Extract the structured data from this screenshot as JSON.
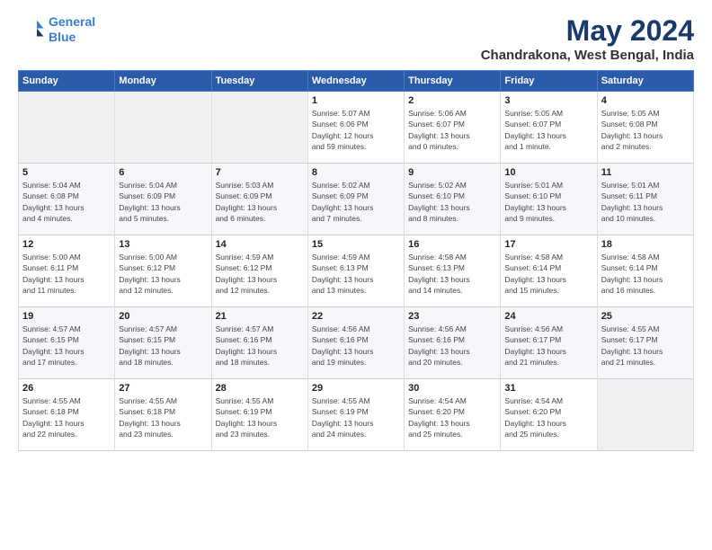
{
  "header": {
    "logo_line1": "General",
    "logo_line2": "Blue",
    "title": "May 2024",
    "location": "Chandrakona, West Bengal, India"
  },
  "weekdays": [
    "Sunday",
    "Monday",
    "Tuesday",
    "Wednesday",
    "Thursday",
    "Friday",
    "Saturday"
  ],
  "weeks": [
    [
      {
        "num": "",
        "info": ""
      },
      {
        "num": "",
        "info": ""
      },
      {
        "num": "",
        "info": ""
      },
      {
        "num": "1",
        "info": "Sunrise: 5:07 AM\nSunset: 6:06 PM\nDaylight: 12 hours\nand 59 minutes."
      },
      {
        "num": "2",
        "info": "Sunrise: 5:06 AM\nSunset: 6:07 PM\nDaylight: 13 hours\nand 0 minutes."
      },
      {
        "num": "3",
        "info": "Sunrise: 5:05 AM\nSunset: 6:07 PM\nDaylight: 13 hours\nand 1 minute."
      },
      {
        "num": "4",
        "info": "Sunrise: 5:05 AM\nSunset: 6:08 PM\nDaylight: 13 hours\nand 2 minutes."
      }
    ],
    [
      {
        "num": "5",
        "info": "Sunrise: 5:04 AM\nSunset: 6:08 PM\nDaylight: 13 hours\nand 4 minutes."
      },
      {
        "num": "6",
        "info": "Sunrise: 5:04 AM\nSunset: 6:09 PM\nDaylight: 13 hours\nand 5 minutes."
      },
      {
        "num": "7",
        "info": "Sunrise: 5:03 AM\nSunset: 6:09 PM\nDaylight: 13 hours\nand 6 minutes."
      },
      {
        "num": "8",
        "info": "Sunrise: 5:02 AM\nSunset: 6:09 PM\nDaylight: 13 hours\nand 7 minutes."
      },
      {
        "num": "9",
        "info": "Sunrise: 5:02 AM\nSunset: 6:10 PM\nDaylight: 13 hours\nand 8 minutes."
      },
      {
        "num": "10",
        "info": "Sunrise: 5:01 AM\nSunset: 6:10 PM\nDaylight: 13 hours\nand 9 minutes."
      },
      {
        "num": "11",
        "info": "Sunrise: 5:01 AM\nSunset: 6:11 PM\nDaylight: 13 hours\nand 10 minutes."
      }
    ],
    [
      {
        "num": "12",
        "info": "Sunrise: 5:00 AM\nSunset: 6:11 PM\nDaylight: 13 hours\nand 11 minutes."
      },
      {
        "num": "13",
        "info": "Sunrise: 5:00 AM\nSunset: 6:12 PM\nDaylight: 13 hours\nand 12 minutes."
      },
      {
        "num": "14",
        "info": "Sunrise: 4:59 AM\nSunset: 6:12 PM\nDaylight: 13 hours\nand 12 minutes."
      },
      {
        "num": "15",
        "info": "Sunrise: 4:59 AM\nSunset: 6:13 PM\nDaylight: 13 hours\nand 13 minutes."
      },
      {
        "num": "16",
        "info": "Sunrise: 4:58 AM\nSunset: 6:13 PM\nDaylight: 13 hours\nand 14 minutes."
      },
      {
        "num": "17",
        "info": "Sunrise: 4:58 AM\nSunset: 6:14 PM\nDaylight: 13 hours\nand 15 minutes."
      },
      {
        "num": "18",
        "info": "Sunrise: 4:58 AM\nSunset: 6:14 PM\nDaylight: 13 hours\nand 16 minutes."
      }
    ],
    [
      {
        "num": "19",
        "info": "Sunrise: 4:57 AM\nSunset: 6:15 PM\nDaylight: 13 hours\nand 17 minutes."
      },
      {
        "num": "20",
        "info": "Sunrise: 4:57 AM\nSunset: 6:15 PM\nDaylight: 13 hours\nand 18 minutes."
      },
      {
        "num": "21",
        "info": "Sunrise: 4:57 AM\nSunset: 6:16 PM\nDaylight: 13 hours\nand 18 minutes."
      },
      {
        "num": "22",
        "info": "Sunrise: 4:56 AM\nSunset: 6:16 PM\nDaylight: 13 hours\nand 19 minutes."
      },
      {
        "num": "23",
        "info": "Sunrise: 4:56 AM\nSunset: 6:16 PM\nDaylight: 13 hours\nand 20 minutes."
      },
      {
        "num": "24",
        "info": "Sunrise: 4:56 AM\nSunset: 6:17 PM\nDaylight: 13 hours\nand 21 minutes."
      },
      {
        "num": "25",
        "info": "Sunrise: 4:55 AM\nSunset: 6:17 PM\nDaylight: 13 hours\nand 21 minutes."
      }
    ],
    [
      {
        "num": "26",
        "info": "Sunrise: 4:55 AM\nSunset: 6:18 PM\nDaylight: 13 hours\nand 22 minutes."
      },
      {
        "num": "27",
        "info": "Sunrise: 4:55 AM\nSunset: 6:18 PM\nDaylight: 13 hours\nand 23 minutes."
      },
      {
        "num": "28",
        "info": "Sunrise: 4:55 AM\nSunset: 6:19 PM\nDaylight: 13 hours\nand 23 minutes."
      },
      {
        "num": "29",
        "info": "Sunrise: 4:55 AM\nSunset: 6:19 PM\nDaylight: 13 hours\nand 24 minutes."
      },
      {
        "num": "30",
        "info": "Sunrise: 4:54 AM\nSunset: 6:20 PM\nDaylight: 13 hours\nand 25 minutes."
      },
      {
        "num": "31",
        "info": "Sunrise: 4:54 AM\nSunset: 6:20 PM\nDaylight: 13 hours\nand 25 minutes."
      },
      {
        "num": "",
        "info": ""
      }
    ]
  ]
}
